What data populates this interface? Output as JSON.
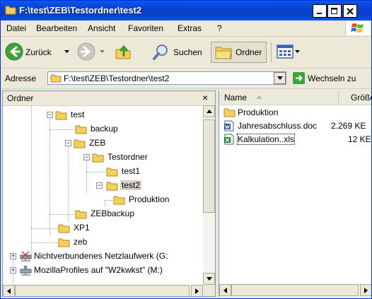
{
  "window": {
    "title": "F:\\test\\ZEB\\Testordner\\test2"
  },
  "menubar": {
    "items": [
      "Datei",
      "Bearbeiten",
      "Ansicht",
      "Favoriten",
      "Extras",
      "?"
    ]
  },
  "toolbar": {
    "back_label": "Zurück",
    "search_label": "Suchen",
    "folders_label": "Ordner"
  },
  "address": {
    "label": "Adresse",
    "value": "F:\\test\\ZEB\\Testordner\\test2",
    "go_label": "Wechseln zu"
  },
  "tree": {
    "header": "Ordner",
    "close_glyph": "×",
    "nodes": [
      {
        "label": "test"
      },
      {
        "label": "backup"
      },
      {
        "label": "ZEB"
      },
      {
        "label": "Testordner"
      },
      {
        "label": "test1"
      },
      {
        "label": "test2"
      },
      {
        "label": "Produktion"
      },
      {
        "label": "ZEBbackup"
      },
      {
        "label": "XP1"
      },
      {
        "label": "zeb"
      },
      {
        "label": "Nichtverbundenes Netzlaufwerk (G:"
      },
      {
        "label": "MozillaProfiles auf \"W2kwkst\" (M:)"
      }
    ]
  },
  "filelist": {
    "columns": {
      "name": "Name",
      "size": "Größe"
    },
    "rows": [
      {
        "name": "Produktion",
        "size": ""
      },
      {
        "name": "Jahresabschluss.doc",
        "size": "2.269 KE"
      },
      {
        "name": "Kalkulation..xls",
        "size": "12 KE"
      }
    ]
  },
  "colors": {
    "titlebar": "#0a4fe0",
    "folder": "#f5cf5c",
    "selection": "#d4d0c8"
  }
}
